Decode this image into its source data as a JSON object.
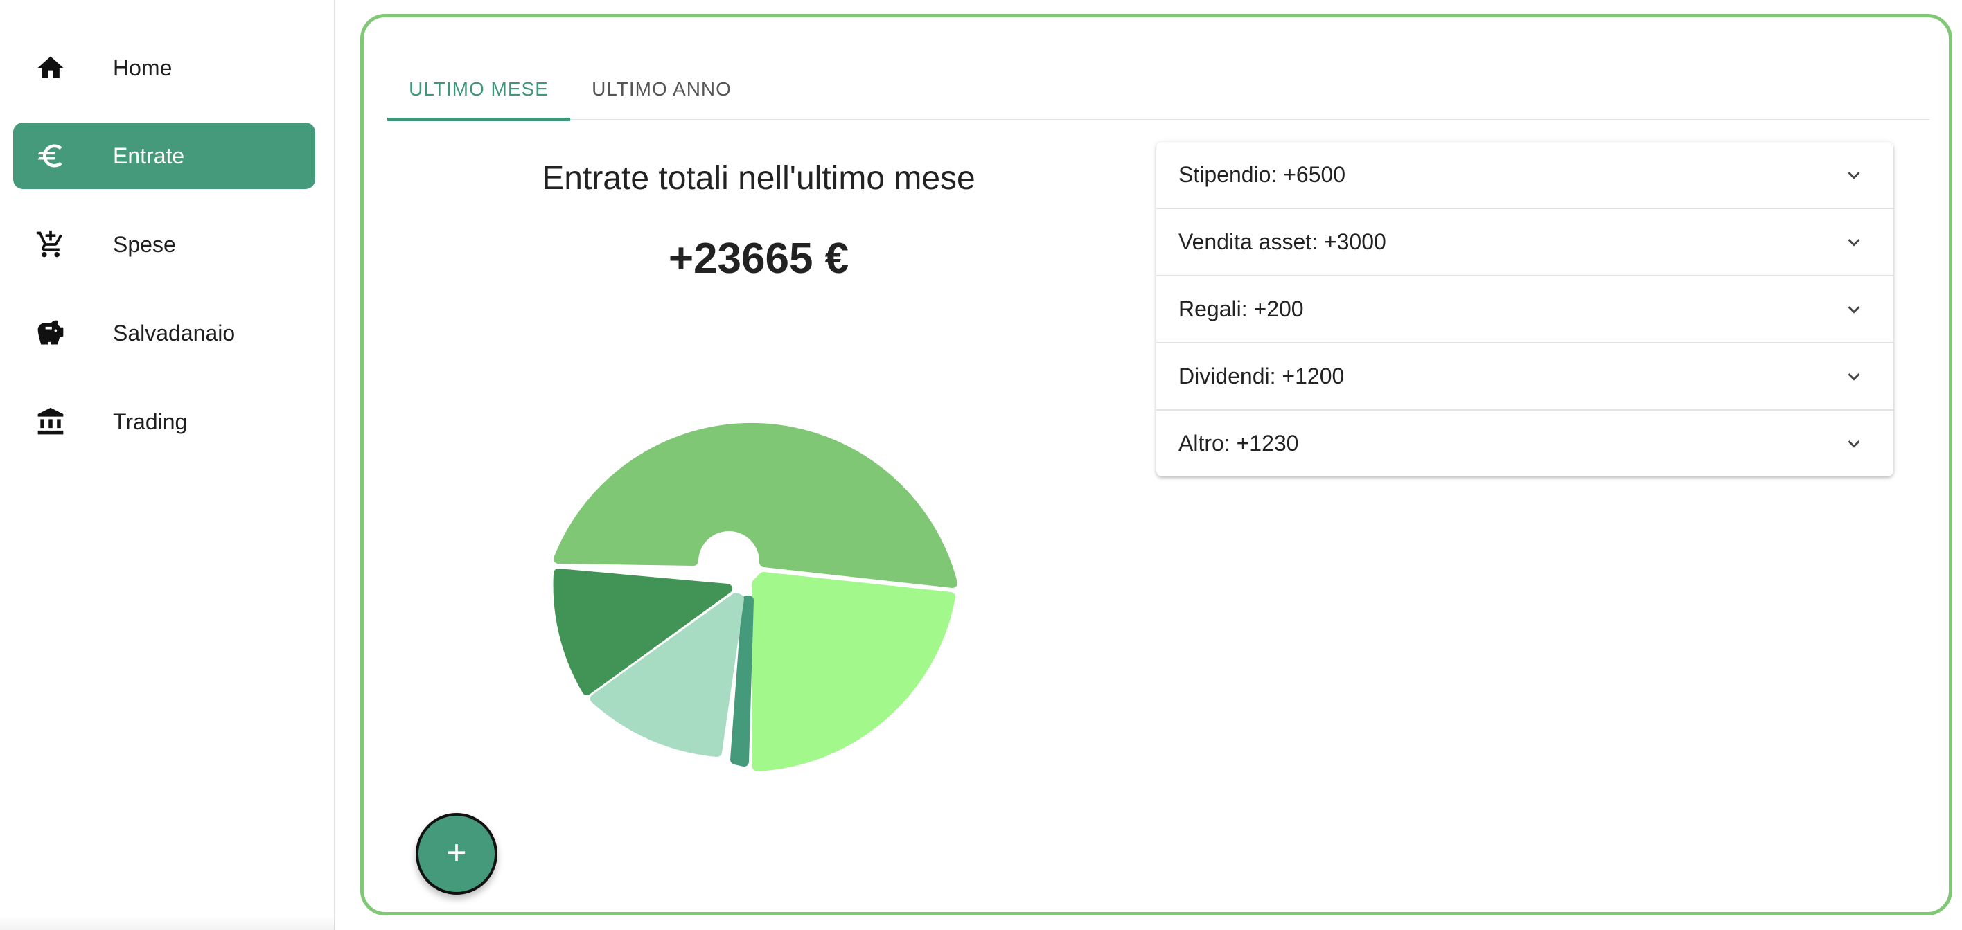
{
  "sidebar": {
    "items": [
      {
        "label": "Home",
        "icon": "home-icon"
      },
      {
        "label": "Entrate",
        "icon": "euro-icon",
        "active": true
      },
      {
        "label": "Spese",
        "icon": "cart-add-icon"
      },
      {
        "label": "Salvadanaio",
        "icon": "piggy-bank-icon"
      },
      {
        "label": "Trading",
        "icon": "bank-icon"
      }
    ]
  },
  "tabs": [
    {
      "label": "ULTIMO MESE",
      "active": true
    },
    {
      "label": "ULTIMO ANNO",
      "active": false
    }
  ],
  "summary": {
    "title": "Entrate totali nell'ultimo mese",
    "total": "+23665 €"
  },
  "categories": [
    {
      "label": "Stipendio: +6500"
    },
    {
      "label": "Vendita asset: +3000"
    },
    {
      "label": "Regali: +200"
    },
    {
      "label": "Dividendi: +1200"
    },
    {
      "label": "Altro: +1230"
    }
  ],
  "fab": {
    "label": "+"
  },
  "colors": {
    "accent": "#459a7c",
    "border": "#80c776",
    "slice_1": "#7fc774",
    "slice_2": "#a2f88b",
    "slice_3": "#469a7c",
    "slice_4": "#a8dcc2",
    "slice_5": "#429356"
  }
}
